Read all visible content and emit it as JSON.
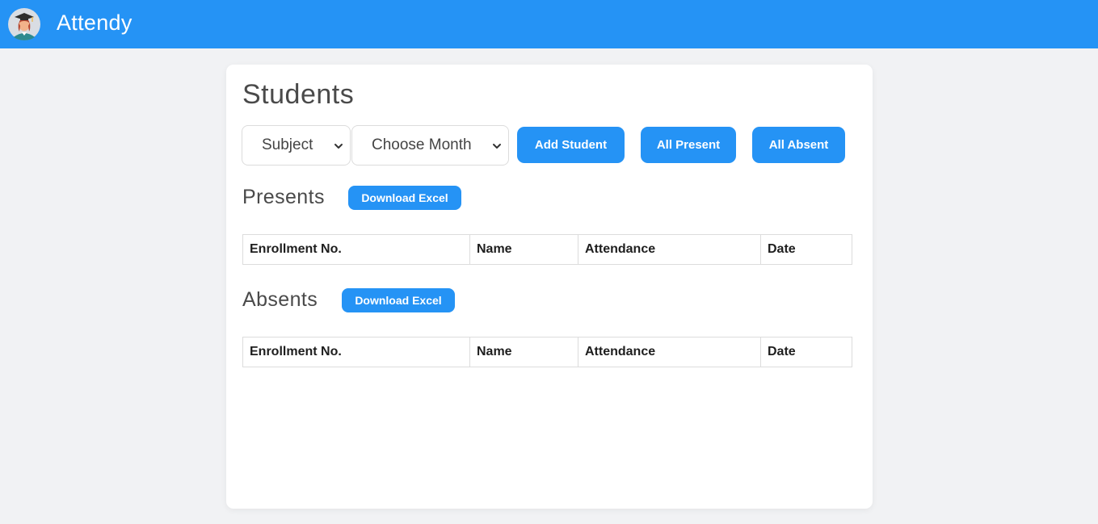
{
  "app": {
    "title": "Attendy"
  },
  "page": {
    "title": "Students"
  },
  "filters": {
    "subject_value": "Subject",
    "month_value": "Choose Month"
  },
  "actions": {
    "add_student": "Add Student",
    "all_present": "All Present",
    "all_absent": "All Absent"
  },
  "presents": {
    "title": "Presents",
    "download_label": "Download Excel",
    "columns": [
      "Enrollment No.",
      "Name",
      "Attendance",
      "Date"
    ]
  },
  "absents": {
    "title": "Absents",
    "download_label": "Download Excel",
    "columns": [
      "Enrollment No.",
      "Name",
      "Attendance",
      "Date"
    ]
  },
  "colors": {
    "primary": "#2593f5",
    "background": "#f1f2f4",
    "card": "#ffffff"
  },
  "icons": {
    "logo": "graduate-avatar-icon",
    "select_arrow": "chevron-down-icon"
  }
}
